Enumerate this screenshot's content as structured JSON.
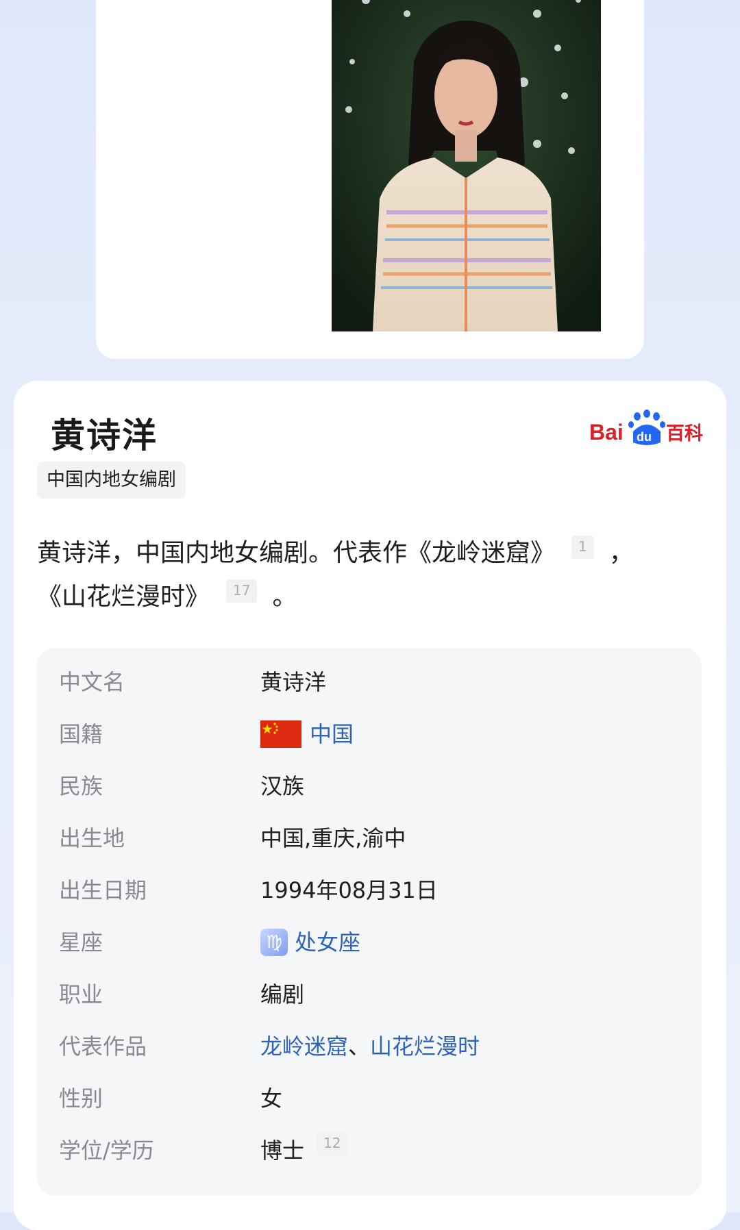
{
  "profile": {
    "name": "黄诗洋",
    "tag": "中国内地女编剧",
    "source_logo": {
      "text_bai": "Bai",
      "text_du": "du",
      "text_baike": "百科"
    },
    "summary": {
      "text_1": "黄诗洋，中国内地女编剧。代表作《龙岭迷窟》",
      "ref_1": "1",
      "text_2": "，",
      "text_3": "《山花烂漫时》",
      "ref_2": "17",
      "text_4": "。"
    }
  },
  "infobox": {
    "rows": [
      {
        "label": "中文名",
        "value": "黄诗洋"
      },
      {
        "label": "国籍",
        "value": "中国"
      },
      {
        "label": "民族",
        "value": "汉族"
      },
      {
        "label": "出生地",
        "value": "中国,重庆,渝中"
      },
      {
        "label": "出生日期",
        "value": "1994年08月31日"
      },
      {
        "label": "星座",
        "value": "处女座",
        "icon": "♍"
      },
      {
        "label": "职业",
        "value": "编剧"
      },
      {
        "label": "代表作品",
        "value_1": "龙岭迷窟",
        "sep": "、",
        "value_2": "山花烂漫时"
      },
      {
        "label": "性别",
        "value": "女"
      },
      {
        "label": "学位/学历",
        "value": "博士",
        "ref": "12"
      }
    ]
  },
  "colors": {
    "link": "#2d63b9",
    "baidu_red": "#de1f26",
    "baidu_blue": "#2468f2"
  }
}
